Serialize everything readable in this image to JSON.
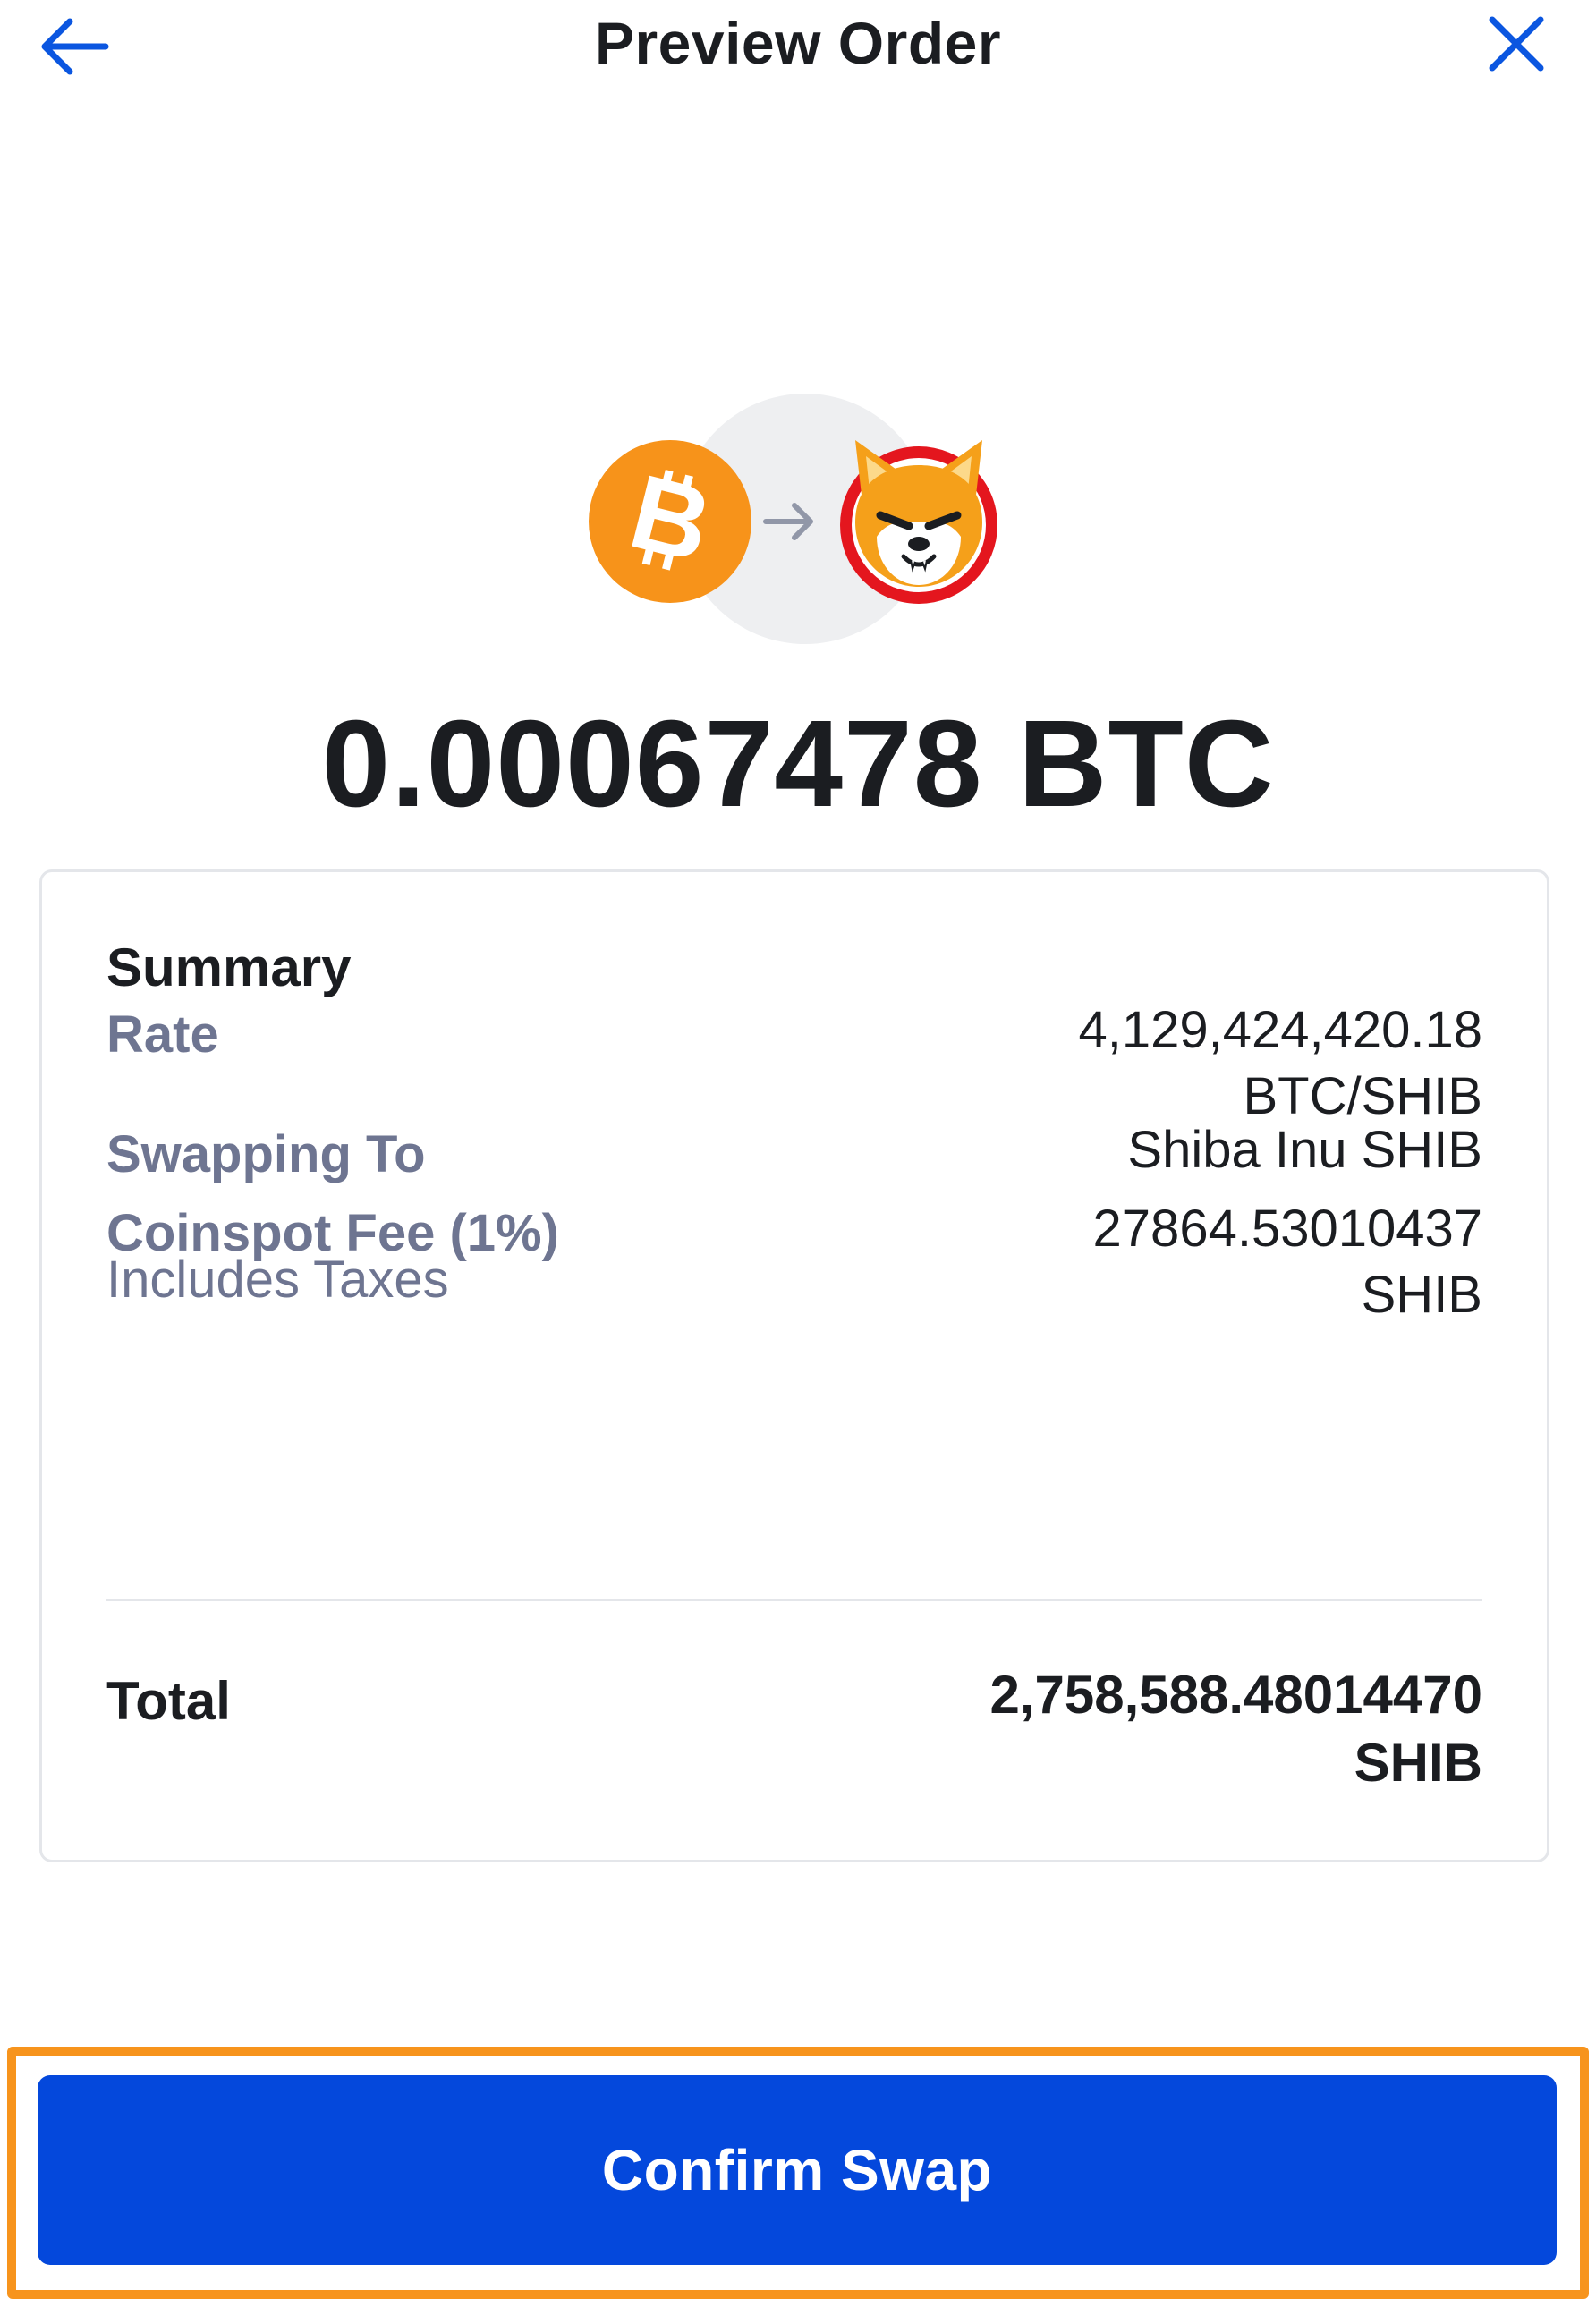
{
  "header": {
    "title": "Preview Order",
    "back_icon": "arrow-left-icon",
    "close_icon": "close-icon",
    "accent_color": "#0b56e0"
  },
  "coins": {
    "from_icon": "bitcoin-icon",
    "arrow_icon": "arrow-right-icon",
    "to_icon": "shiba-inu-icon"
  },
  "amount": "0.00067478 BTC",
  "summary": {
    "title": "Summary",
    "rows": [
      {
        "label": "Rate",
        "value_line1": "4,129,424,420.18",
        "value_line2": "BTC/SHIB"
      },
      {
        "label": "Swapping To",
        "value_line1": "Shiba Inu SHIB"
      },
      {
        "label": "Coinspot Fee (1%)",
        "sublabel": "Includes Taxes",
        "value_line1": "27864.53010437",
        "value_line2": "SHIB"
      }
    ],
    "total": {
      "label": "Total",
      "value_line1": "2,758,588.48014470",
      "value_line2": "SHIB"
    }
  },
  "confirm_button": {
    "label": "Confirm Swap",
    "color": "#0448dc"
  },
  "highlight_color": "#f7941d"
}
